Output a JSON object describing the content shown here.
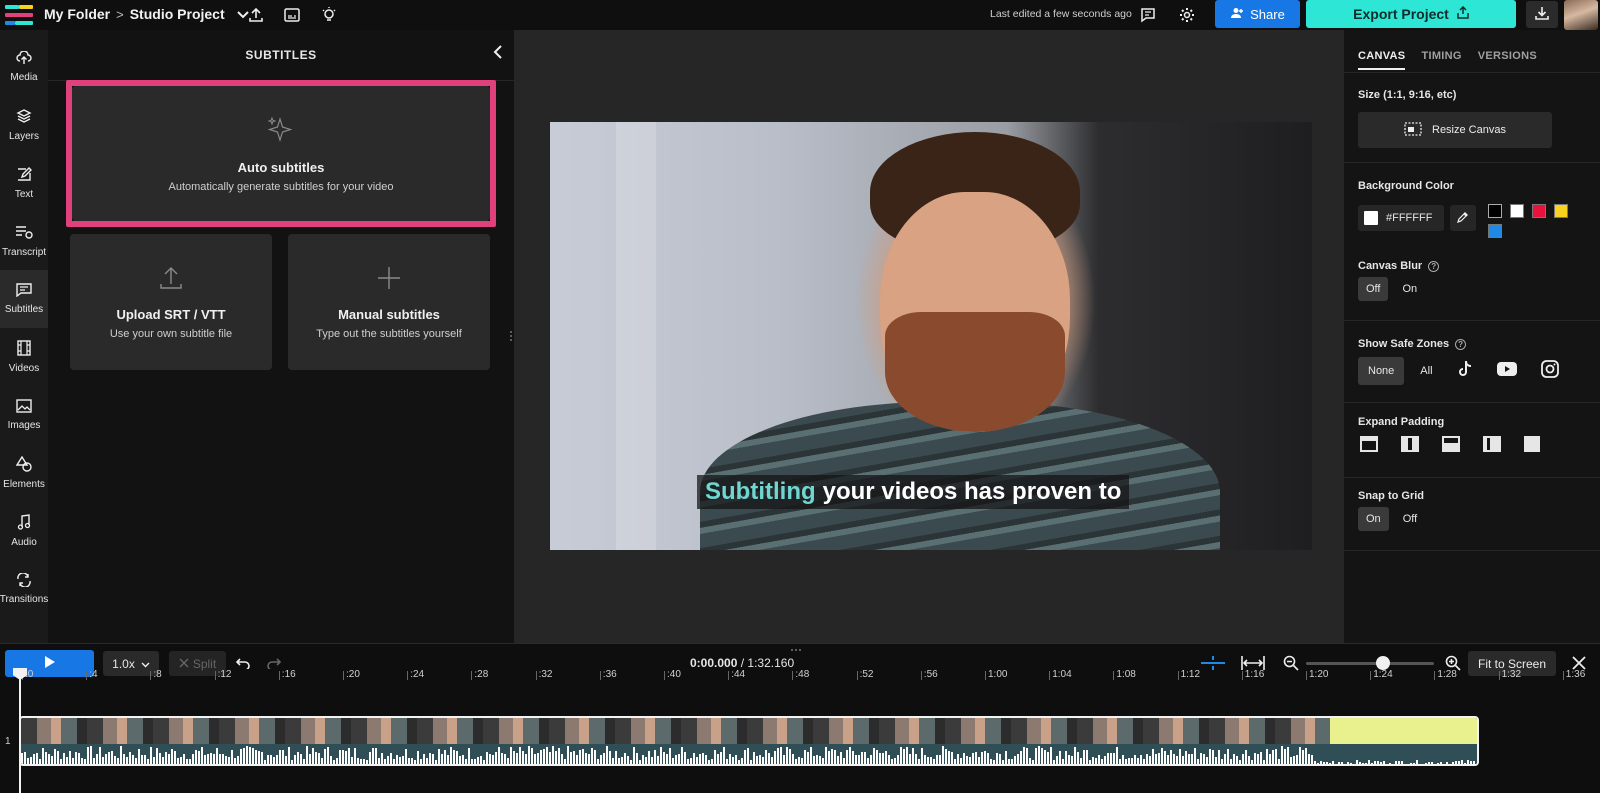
{
  "header": {
    "breadcrumb_folder": "My Folder",
    "breadcrumb_sep": ">",
    "project_name": "Studio Project",
    "last_edited": "Last edited a few seconds ago",
    "share_label": "Share",
    "export_label": "Export Project"
  },
  "leftnav": {
    "items": [
      {
        "label": "Media",
        "icon": "upload-cloud-icon"
      },
      {
        "label": "Layers",
        "icon": "layers-icon"
      },
      {
        "label": "Text",
        "icon": "text-edit-icon"
      },
      {
        "label": "Transcript",
        "icon": "transcript-icon"
      },
      {
        "label": "Subtitles",
        "icon": "subtitles-icon",
        "active": true
      },
      {
        "label": "Videos",
        "icon": "film-icon"
      },
      {
        "label": "Images",
        "icon": "image-icon"
      },
      {
        "label": "Elements",
        "icon": "shapes-icon"
      },
      {
        "label": "Audio",
        "icon": "music-note-icon"
      },
      {
        "label": "Transitions",
        "icon": "transition-icon"
      }
    ]
  },
  "subtitles_panel": {
    "title": "SUBTITLES",
    "auto": {
      "title": "Auto subtitles",
      "subtitle": "Automatically generate subtitles for your video"
    },
    "upload": {
      "title": "Upload SRT / VTT",
      "subtitle": "Use your own subtitle file"
    },
    "manual": {
      "title": "Manual subtitles",
      "subtitle": "Type out the subtitles yourself"
    }
  },
  "video": {
    "subtitle_highlight": "Subtitling",
    "subtitle_rest": "your videos has proven to"
  },
  "right_panel": {
    "tabs": [
      {
        "label": "CANVAS",
        "active": true
      },
      {
        "label": "TIMING",
        "active": false
      },
      {
        "label": "VERSIONS",
        "active": false
      }
    ],
    "size_label": "Size (1:1, 9:16, etc)",
    "resize_label": "Resize Canvas",
    "bg_color_label": "Background Color",
    "bg_color_value": "#FFFFFF",
    "swatches": [
      "#000000",
      "#ffffff",
      "#e8123c",
      "#f7d21e",
      "#1f8ae6"
    ],
    "canvas_blur_label": "Canvas Blur",
    "blur_off": "Off",
    "blur_on": "On",
    "safe_zones_label": "Show Safe Zones",
    "safe_none": "None",
    "safe_all": "All",
    "expand_padding_label": "Expand Padding",
    "snap_label": "Snap to Grid",
    "snap_on": "On",
    "snap_off": "Off"
  },
  "timeline": {
    "speed": "1.0x",
    "split_label": "Split",
    "current_time": "0:00.000",
    "time_sep": "/",
    "total_time": "1:32.160",
    "fit_label": "Fit to Screen",
    "track_number": "1",
    "zoom_level": 0.6,
    "ruler": [
      ":0",
      ":4",
      ":8",
      ":12",
      ":16",
      ":20",
      ":24",
      ":28",
      ":32",
      ":36",
      ":40",
      ":44",
      ":48",
      ":52",
      ":56",
      "1:00",
      "1:04",
      "1:08",
      "1:12",
      "1:16",
      "1:20",
      "1:24",
      "1:28",
      "1:32",
      "1:36"
    ]
  },
  "colors": {
    "share": "#1677e5",
    "export": "#2ee6d6",
    "highlight_border": "#e0407b",
    "subtitle_highlight": "#6fd6d0"
  }
}
